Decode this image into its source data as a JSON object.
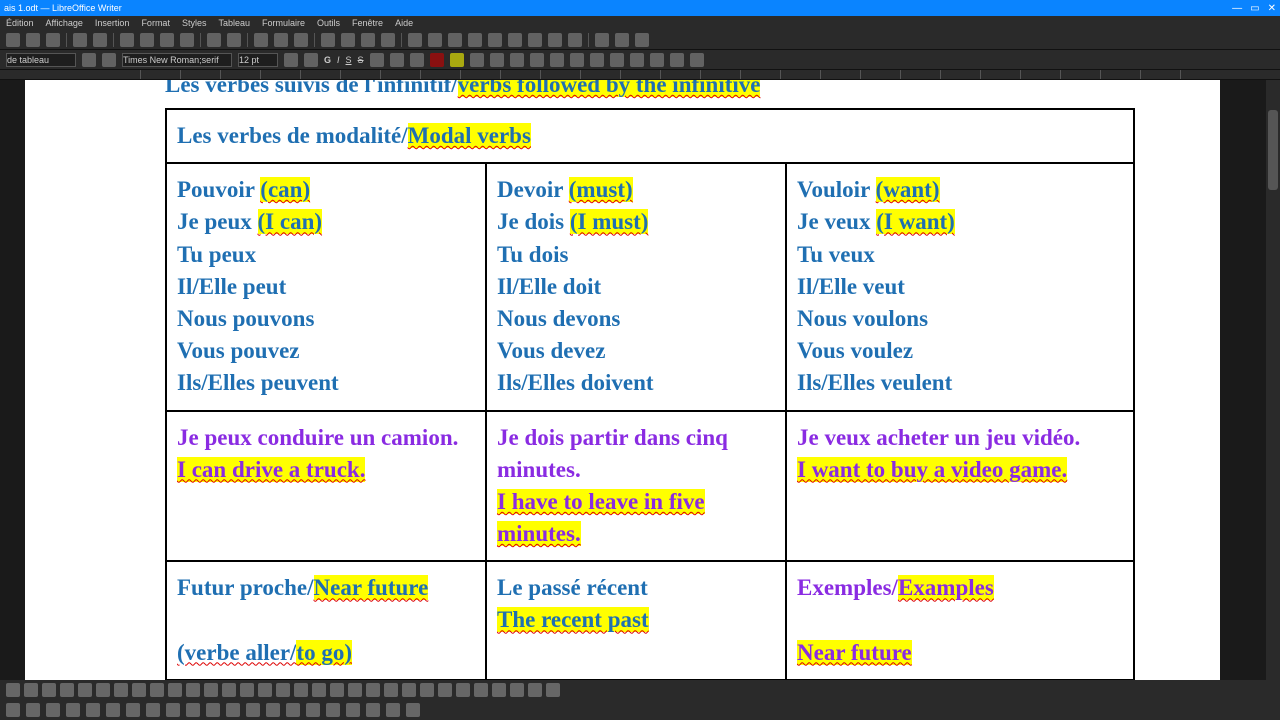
{
  "window": {
    "title": "ais 1.odt — LibreOffice Writer"
  },
  "menu": [
    "Édition",
    "Affichage",
    "Insertion",
    "Format",
    "Styles",
    "Tableau",
    "Formulaire",
    "Outils",
    "Fenêtre",
    "Aide"
  ],
  "toolbar2": {
    "styleLabel": "de tableau",
    "font": "Times New Roman;serif",
    "size": "12 pt",
    "bold": "G",
    "italic": "I",
    "underline": "S",
    "strike": "S"
  },
  "doc": {
    "heading_plain": "Les verbes suivis de l'infinitif/",
    "heading_hl": "verbs followed by the infinitive",
    "row1": {
      "plain": "Les verbes de modalité/",
      "hl": "Modal verbs"
    },
    "colA": {
      "title_plain": "Pouvoir ",
      "title_hl": "(can)",
      "l1a": "Je peux ",
      "l1b": "(I can)",
      "l2": "Tu peux",
      "l3": "Il/Elle peut",
      "l4": "Nous pouvons",
      "l5": "Vous pouvez",
      "l6": "Ils/Elles peuvent"
    },
    "colB": {
      "title_plain": "Devoir ",
      "title_hl": "(must)",
      "l1a": "Je dois ",
      "l1b": "(I must)",
      "l2": "Tu dois",
      "l3": "Il/Elle doit",
      "l4": "Nous devons",
      "l5": "Vous devez",
      "l6": "Ils/Elles doivent"
    },
    "colC": {
      "title_plain": "Vouloir ",
      "title_hl": "(want)",
      "l1a": "Je veux ",
      "l1b": "(I want)",
      "l2": "Tu veux",
      "l3": "Il/Elle veut",
      "l4": "Nous voulons",
      "l5": "Vous voulez",
      "l6": "Ils/Elles veulent"
    },
    "exA": {
      "fr": "Je peux conduire un camion.",
      "en": "I can drive a truck."
    },
    "exB": {
      "fr": "Je dois partir dans cinq minutes.",
      "en": "I have to leave in five minutes."
    },
    "exC": {
      "fr": "Je veux acheter un jeu vidéo.",
      "en": "I want to buy a video game."
    },
    "row4A": {
      "a": "Futur proche/",
      "b": "Near future",
      "c": "(verbe aller/",
      "d": "to go)"
    },
    "row4B": {
      "a": "Le passé récent",
      "b": "The recent past"
    },
    "row4C": {
      "a": "Exemples/",
      "b": "Examples",
      "c": "Near future"
    }
  }
}
